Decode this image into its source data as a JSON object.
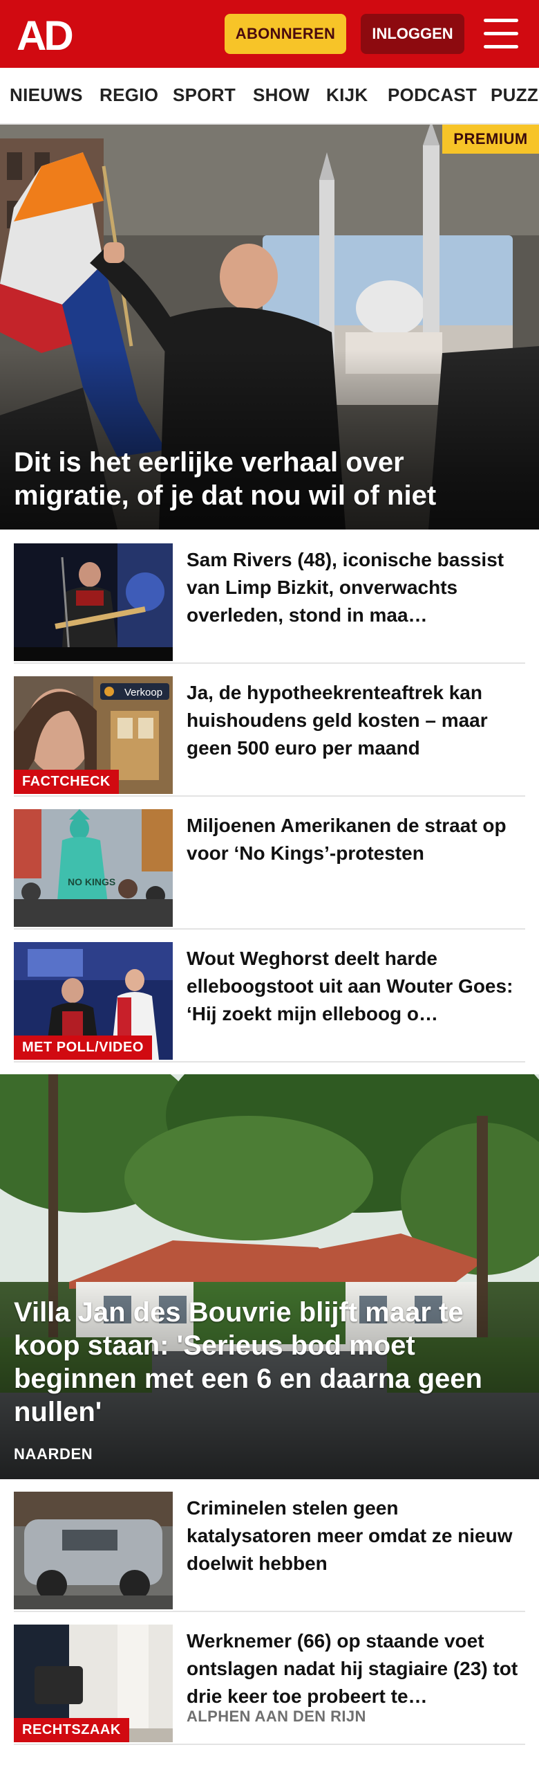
{
  "header": {
    "logo_text": "AD",
    "subscribe_label": "ABONNEREN",
    "login_label": "INLOGGEN",
    "brand_color": "#d10a11",
    "accent_color": "#f7c428"
  },
  "nav": {
    "items": [
      {
        "label": "NIEUWS"
      },
      {
        "label": "REGIO"
      },
      {
        "label": "SPORT"
      },
      {
        "label": "SHOW"
      },
      {
        "label": "KIJK"
      },
      {
        "label": "PODCAST"
      },
      {
        "label": "PUZZ"
      }
    ]
  },
  "hero": {
    "badge": "PREMIUM",
    "title": "Dit is het eerlijke verhaal over migratie, of je dat nou wil of niet"
  },
  "articles": [
    {
      "title": "Sam Rivers (48), iconische bassist van Limp Bizkit, onver­wachts overleden, stond in maa…",
      "badge": "",
      "location": ""
    },
    {
      "title": "Ja, de hypotheekrenteaftrek kan huishoudens geld kosten – maar geen 500 euro per maand",
      "badge": "FACTCHECK",
      "location": "",
      "thumb_sign": "Verkoop"
    },
    {
      "title": "Miljoenen Amerikanen de straat op voor ‘No Kings’-protesten",
      "badge": "",
      "location": "",
      "thumb_sign": "NO KINGS"
    },
    {
      "title": "Wout Weghorst deelt harde elleboogstoot uit aan Wouter Goes: ‘Hij zoekt mijn elleboog o…",
      "badge": "MET POLL/VIDEO",
      "location": ""
    }
  ],
  "hero2": {
    "title": "Villa Jan des Bouvrie blijft maar te koop staan: 'Serieus bod moet beginnen met een 6 en daarna geen nullen'",
    "location": "NAARDEN"
  },
  "articles2": [
    {
      "title": "Criminelen stelen geen katalysatoren meer omdat ze nieuw doelwit hebben",
      "badge": "",
      "location": ""
    },
    {
      "title": "Werknemer (66) op staande voet ontslagen nadat hij stagiaire (23) tot drie keer toe probeert te…",
      "badge": "RECHTSZAAK",
      "location": "ALPHEN AAN DEN RIJN"
    }
  ]
}
